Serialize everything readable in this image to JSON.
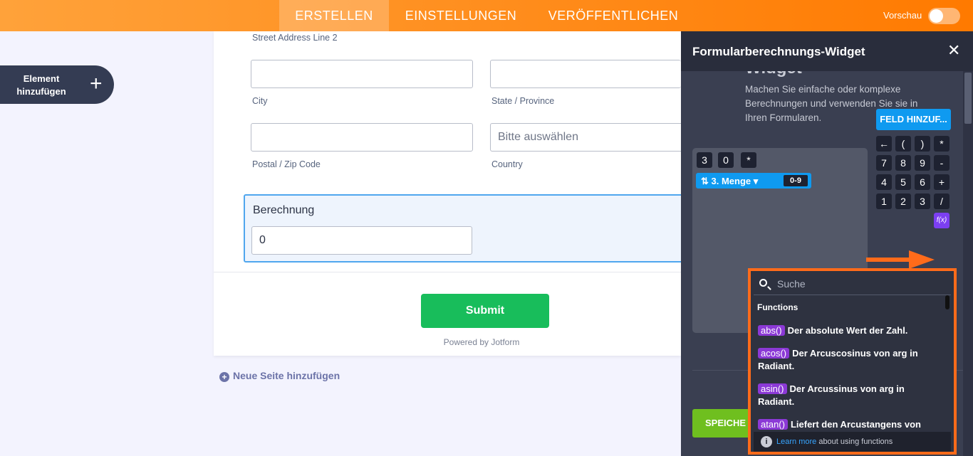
{
  "topbar": {
    "tabs": [
      "ERSTELLEN",
      "EINSTELLUNGEN",
      "VERÖFFENTLICHEN"
    ],
    "preview_label": "Vorschau"
  },
  "add_element": {
    "label": "Element hinzufügen",
    "icon": "plus-icon"
  },
  "form": {
    "street_line2_label": "Street Address Line 2",
    "city_label": "City",
    "state_label": "State / Province",
    "postal_label": "Postal / Zip Code",
    "country_label": "Country",
    "country_placeholder": "Bitte auswählen",
    "calc_title": "Berechnung",
    "calc_value": "0",
    "submit_label": "Submit",
    "powered_by": "Powered by Jotform",
    "new_page_label": "Neue Seite hinzufügen"
  },
  "panel": {
    "title": "Formularberechnungs-Widget",
    "widget_title": "Widget",
    "description": "Machen Sie einfache oder komplexe Berechnungen und verwenden Sie sie in Ihren Formularen.",
    "formula_chips": [
      "3",
      "0",
      "*"
    ],
    "field_chip_label": "3. Menge",
    "field_chip_badge": "0-9",
    "add_field_label": "FELD HINZUF...",
    "keypad": [
      [
        "←",
        "(",
        ")",
        "*"
      ],
      [
        "7",
        "8",
        "9",
        "-"
      ],
      [
        "4",
        "5",
        "6",
        "+"
      ],
      [
        "1",
        "2",
        "3",
        "/"
      ]
    ],
    "fx_label": "f(x)",
    "save_label": "SPEICHE",
    "accent_color": "#0f9af0"
  },
  "functions_popup": {
    "search_placeholder": "Suche",
    "heading": "Functions",
    "items": [
      {
        "name": "abs()",
        "desc": "Der absolute Wert der Zahl."
      },
      {
        "name": "acos()",
        "desc": "Der Arcuscosinus von arg in Radiant."
      },
      {
        "name": "asin()",
        "desc": "Der Arcussinus von arg in Radiant."
      },
      {
        "name": "atan()",
        "desc": "Liefert den Arcustangens von"
      }
    ],
    "footer_link": "Learn more",
    "footer_text": " about using functions",
    "highlight_color": "#ff6b1a"
  }
}
